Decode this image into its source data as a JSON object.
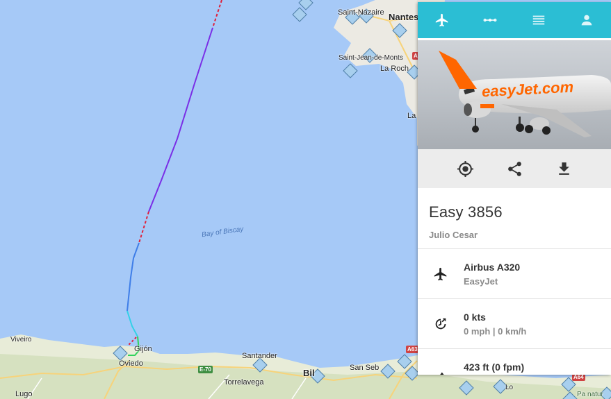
{
  "map": {
    "labels": {
      "nantes": "Nantes",
      "saint_nazaire": "Saint-Nazaire",
      "saint_jean_de_monts": "Saint-Jean-de-Monts",
      "la_roche": "La Roch",
      "la": "La",
      "bay_of_biscay": "Bay of Biscay",
      "viveiro": "Viveiro",
      "gijon": "Gijón",
      "oviedo": "Oviedo",
      "santander": "Santander",
      "torrelavega": "Torrelavega",
      "bilbao": "Bil",
      "san_sebastian": "San Seb",
      "lugo": "Lugo",
      "lo": "Lo",
      "parc_natur": "Pa natur"
    },
    "road_badges": {
      "a63": "A63",
      "e70": "E-70",
      "a64": "A64",
      "a_top": "A"
    },
    "colors": {
      "water": "#a6c9f7",
      "track_purple": "#7a2ee6",
      "track_blue": "#3f7ee8",
      "track_cyan": "#33d1e8",
      "track_green": "#2fd35a",
      "track_dashed": "#e0203a",
      "airport_marker": "#a8cfee"
    }
  },
  "panel": {
    "tabs": [
      {
        "icon": "airplane-icon",
        "active": true
      },
      {
        "icon": "route-icon",
        "active": false
      },
      {
        "icon": "list-icon",
        "active": false
      },
      {
        "icon": "person-icon",
        "active": false
      }
    ],
    "actions": [
      {
        "icon": "locate-icon"
      },
      {
        "icon": "share-icon"
      },
      {
        "icon": "download-icon"
      }
    ],
    "flight": {
      "title": "Easy 3856",
      "aircraft_name": "Julio Cesar"
    },
    "rows": [
      {
        "icon": "airplane-icon",
        "primary": "Airbus A320",
        "secondary": "EasyJet"
      },
      {
        "icon": "speed-icon",
        "primary": "0 kts",
        "secondary": "0 mph | 0 km/h"
      },
      {
        "icon": "altitude-icon",
        "primary": "423 ft (0 fpm)",
        "secondary": ""
      }
    ],
    "photo_livery_text": "easyJet.com",
    "colors": {
      "tab_bar": "#2bbed4",
      "tab_underline": "#e0574f",
      "livery_orange": "#ff6600"
    }
  }
}
